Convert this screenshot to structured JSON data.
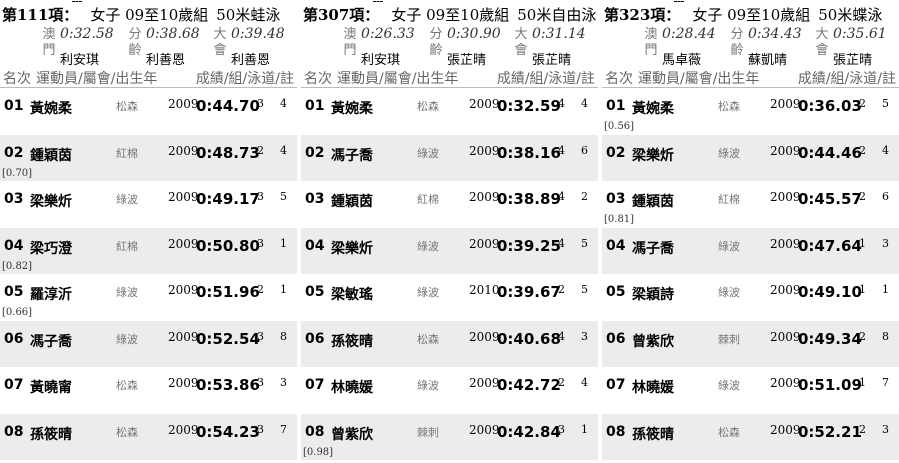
{
  "events": [
    {
      "number": "第111項：",
      "category": "女子 09至10歲組",
      "distance": "50米蛙泳",
      "records": [
        {
          "label": "澳門",
          "time": "0:32.58",
          "holder": "利安琪"
        },
        {
          "label": "分齡",
          "time": "0:38.68",
          "holder": "利善恩"
        },
        {
          "label": "大會",
          "time": "0:39.48",
          "holder": "利善恩"
        }
      ],
      "header": {
        "rank": "名次",
        "swimmer": "運動員/屬會/出生年",
        "result": "成績/組/泳道/註"
      },
      "rows": [
        {
          "rank": "01",
          "name": "黃婉柔",
          "club": "松森",
          "year": "2009",
          "time": "0:44.70",
          "heat": "3",
          "lane": "4",
          "reaction": ""
        },
        {
          "rank": "02",
          "name": "鍾穎茵",
          "club": "紅棉",
          "year": "2009",
          "time": "0:48.73",
          "heat": "2",
          "lane": "4",
          "reaction": "[0.70]"
        },
        {
          "rank": "03",
          "name": "梁樂炘",
          "club": "綠波",
          "year": "2009",
          "time": "0:49.17",
          "heat": "3",
          "lane": "5",
          "reaction": ""
        },
        {
          "rank": "04",
          "name": "梁巧澄",
          "club": "紅棉",
          "year": "2009",
          "time": "0:50.80",
          "heat": "3",
          "lane": "1",
          "reaction": "[0.82]"
        },
        {
          "rank": "05",
          "name": "羅淳沂",
          "club": "綠波",
          "year": "2009",
          "time": "0:51.96",
          "heat": "2",
          "lane": "1",
          "reaction": "[0.66]"
        },
        {
          "rank": "06",
          "name": "馮子喬",
          "club": "綠波",
          "year": "2009",
          "time": "0:52.54",
          "heat": "3",
          "lane": "8",
          "reaction": ""
        },
        {
          "rank": "07",
          "name": "黃曉甯",
          "club": "松森",
          "year": "2009",
          "time": "0:53.86",
          "heat": "3",
          "lane": "3",
          "reaction": ""
        },
        {
          "rank": "08",
          "name": "孫筱晴",
          "club": "松森",
          "year": "2009",
          "time": "0:54.23",
          "heat": "3",
          "lane": "7",
          "reaction": ""
        }
      ]
    },
    {
      "number": "第307項：",
      "category": "女子 09至10歲組",
      "distance": "50米自由泳",
      "records": [
        {
          "label": "澳門",
          "time": "0:26.33",
          "holder": "利安琪"
        },
        {
          "label": "分齡",
          "time": "0:30.90",
          "holder": "張芷晴"
        },
        {
          "label": "大會",
          "time": "0:31.14",
          "holder": "張芷晴"
        }
      ],
      "header": {
        "rank": "名次",
        "swimmer": "運動員/屬會/出生年",
        "result": "成績/組/泳道/註"
      },
      "rows": [
        {
          "rank": "01",
          "name": "黃婉柔",
          "club": "松森",
          "year": "2009",
          "time": "0:32.59",
          "heat": "4",
          "lane": "4",
          "reaction": ""
        },
        {
          "rank": "02",
          "name": "馮子喬",
          "club": "綠波",
          "year": "2009",
          "time": "0:38.16",
          "heat": "4",
          "lane": "6",
          "reaction": ""
        },
        {
          "rank": "03",
          "name": "鍾穎茵",
          "club": "紅棉",
          "year": "2009",
          "time": "0:38.89",
          "heat": "4",
          "lane": "2",
          "reaction": ""
        },
        {
          "rank": "04",
          "name": "梁樂炘",
          "club": "綠波",
          "year": "2009",
          "time": "0:39.25",
          "heat": "4",
          "lane": "5",
          "reaction": ""
        },
        {
          "rank": "05",
          "name": "梁敏瑤",
          "club": "綠波",
          "year": "2010",
          "time": "0:39.67",
          "heat": "2",
          "lane": "5",
          "reaction": ""
        },
        {
          "rank": "06",
          "name": "孫筱晴",
          "club": "松森",
          "year": "2009",
          "time": "0:40.68",
          "heat": "4",
          "lane": "3",
          "reaction": ""
        },
        {
          "rank": "07",
          "name": "林曉媛",
          "club": "綠波",
          "year": "2009",
          "time": "0:42.72",
          "heat": "2",
          "lane": "4",
          "reaction": ""
        },
        {
          "rank": "08",
          "name": "曾紫欣",
          "club": "棘刺",
          "year": "2009",
          "time": "0:42.84",
          "heat": "3",
          "lane": "1",
          "reaction": "[0.98]"
        }
      ]
    },
    {
      "number": "第323項：",
      "category": "女子 09至10歲組",
      "distance": "50米蝶泳",
      "records": [
        {
          "label": "澳門",
          "time": "0:28.44",
          "holder": "馬卓薇"
        },
        {
          "label": "分齡",
          "time": "0:34.43",
          "holder": "蘇凱晴"
        },
        {
          "label": "大會",
          "time": "0:35.61",
          "holder": "張芷晴"
        }
      ],
      "header": {
        "rank": "名次",
        "swimmer": "運動員/屬會/出生年",
        "result": "成績/組/泳道/註"
      },
      "rows": [
        {
          "rank": "01",
          "name": "黃婉柔",
          "club": "松森",
          "year": "2009",
          "time": "0:36.03",
          "heat": "2",
          "lane": "5",
          "reaction": "[0.56]"
        },
        {
          "rank": "02",
          "name": "梁樂炘",
          "club": "綠波",
          "year": "2009",
          "time": "0:44.46",
          "heat": "2",
          "lane": "4",
          "reaction": ""
        },
        {
          "rank": "03",
          "name": "鍾穎茵",
          "club": "紅棉",
          "year": "2009",
          "time": "0:45.57",
          "heat": "2",
          "lane": "6",
          "reaction": "[0.81]"
        },
        {
          "rank": "04",
          "name": "馮子喬",
          "club": "綠波",
          "year": "2009",
          "time": "0:47.64",
          "heat": "1",
          "lane": "3",
          "reaction": ""
        },
        {
          "rank": "05",
          "name": "梁穎詩",
          "club": "綠波",
          "year": "2009",
          "time": "0:49.10",
          "heat": "1",
          "lane": "1",
          "reaction": ""
        },
        {
          "rank": "06",
          "name": "曾紫欣",
          "club": "棘刺",
          "year": "2009",
          "time": "0:49.34",
          "heat": "2",
          "lane": "8",
          "reaction": ""
        },
        {
          "rank": "07",
          "name": "林曉媛",
          "club": "綠波",
          "year": "2009",
          "time": "0:51.09",
          "heat": "1",
          "lane": "7",
          "reaction": ""
        },
        {
          "rank": "08",
          "name": "孫筱晴",
          "club": "松森",
          "year": "2009",
          "time": "0:52.21",
          "heat": "2",
          "lane": "3",
          "reaction": ""
        }
      ]
    }
  ]
}
